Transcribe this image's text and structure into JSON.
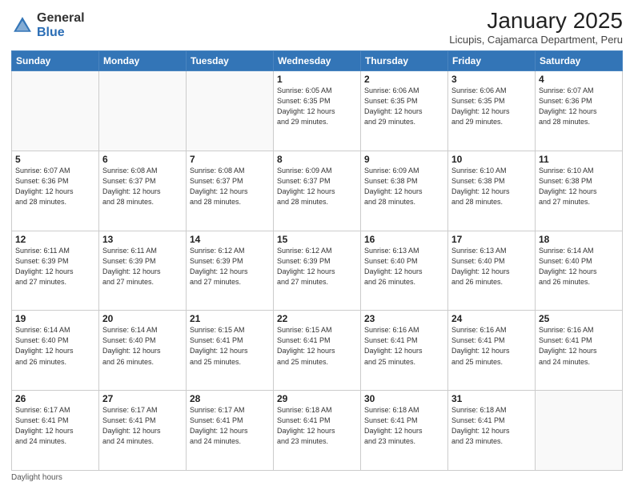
{
  "logo": {
    "general": "General",
    "blue": "Blue"
  },
  "header": {
    "title": "January 2025",
    "subtitle": "Licupis, Cajamarca Department, Peru"
  },
  "days_of_week": [
    "Sunday",
    "Monday",
    "Tuesday",
    "Wednesday",
    "Thursday",
    "Friday",
    "Saturday"
  ],
  "footer": {
    "note": "Daylight hours"
  },
  "weeks": [
    [
      {
        "day": "",
        "info": ""
      },
      {
        "day": "",
        "info": ""
      },
      {
        "day": "",
        "info": ""
      },
      {
        "day": "1",
        "info": "Sunrise: 6:05 AM\nSunset: 6:35 PM\nDaylight: 12 hours\nand 29 minutes."
      },
      {
        "day": "2",
        "info": "Sunrise: 6:06 AM\nSunset: 6:35 PM\nDaylight: 12 hours\nand 29 minutes."
      },
      {
        "day": "3",
        "info": "Sunrise: 6:06 AM\nSunset: 6:35 PM\nDaylight: 12 hours\nand 29 minutes."
      },
      {
        "day": "4",
        "info": "Sunrise: 6:07 AM\nSunset: 6:36 PM\nDaylight: 12 hours\nand 28 minutes."
      }
    ],
    [
      {
        "day": "5",
        "info": "Sunrise: 6:07 AM\nSunset: 6:36 PM\nDaylight: 12 hours\nand 28 minutes."
      },
      {
        "day": "6",
        "info": "Sunrise: 6:08 AM\nSunset: 6:37 PM\nDaylight: 12 hours\nand 28 minutes."
      },
      {
        "day": "7",
        "info": "Sunrise: 6:08 AM\nSunset: 6:37 PM\nDaylight: 12 hours\nand 28 minutes."
      },
      {
        "day": "8",
        "info": "Sunrise: 6:09 AM\nSunset: 6:37 PM\nDaylight: 12 hours\nand 28 minutes."
      },
      {
        "day": "9",
        "info": "Sunrise: 6:09 AM\nSunset: 6:38 PM\nDaylight: 12 hours\nand 28 minutes."
      },
      {
        "day": "10",
        "info": "Sunrise: 6:10 AM\nSunset: 6:38 PM\nDaylight: 12 hours\nand 28 minutes."
      },
      {
        "day": "11",
        "info": "Sunrise: 6:10 AM\nSunset: 6:38 PM\nDaylight: 12 hours\nand 27 minutes."
      }
    ],
    [
      {
        "day": "12",
        "info": "Sunrise: 6:11 AM\nSunset: 6:39 PM\nDaylight: 12 hours\nand 27 minutes."
      },
      {
        "day": "13",
        "info": "Sunrise: 6:11 AM\nSunset: 6:39 PM\nDaylight: 12 hours\nand 27 minutes."
      },
      {
        "day": "14",
        "info": "Sunrise: 6:12 AM\nSunset: 6:39 PM\nDaylight: 12 hours\nand 27 minutes."
      },
      {
        "day": "15",
        "info": "Sunrise: 6:12 AM\nSunset: 6:39 PM\nDaylight: 12 hours\nand 27 minutes."
      },
      {
        "day": "16",
        "info": "Sunrise: 6:13 AM\nSunset: 6:40 PM\nDaylight: 12 hours\nand 26 minutes."
      },
      {
        "day": "17",
        "info": "Sunrise: 6:13 AM\nSunset: 6:40 PM\nDaylight: 12 hours\nand 26 minutes."
      },
      {
        "day": "18",
        "info": "Sunrise: 6:14 AM\nSunset: 6:40 PM\nDaylight: 12 hours\nand 26 minutes."
      }
    ],
    [
      {
        "day": "19",
        "info": "Sunrise: 6:14 AM\nSunset: 6:40 PM\nDaylight: 12 hours\nand 26 minutes."
      },
      {
        "day": "20",
        "info": "Sunrise: 6:14 AM\nSunset: 6:40 PM\nDaylight: 12 hours\nand 26 minutes."
      },
      {
        "day": "21",
        "info": "Sunrise: 6:15 AM\nSunset: 6:41 PM\nDaylight: 12 hours\nand 25 minutes."
      },
      {
        "day": "22",
        "info": "Sunrise: 6:15 AM\nSunset: 6:41 PM\nDaylight: 12 hours\nand 25 minutes."
      },
      {
        "day": "23",
        "info": "Sunrise: 6:16 AM\nSunset: 6:41 PM\nDaylight: 12 hours\nand 25 minutes."
      },
      {
        "day": "24",
        "info": "Sunrise: 6:16 AM\nSunset: 6:41 PM\nDaylight: 12 hours\nand 25 minutes."
      },
      {
        "day": "25",
        "info": "Sunrise: 6:16 AM\nSunset: 6:41 PM\nDaylight: 12 hours\nand 24 minutes."
      }
    ],
    [
      {
        "day": "26",
        "info": "Sunrise: 6:17 AM\nSunset: 6:41 PM\nDaylight: 12 hours\nand 24 minutes."
      },
      {
        "day": "27",
        "info": "Sunrise: 6:17 AM\nSunset: 6:41 PM\nDaylight: 12 hours\nand 24 minutes."
      },
      {
        "day": "28",
        "info": "Sunrise: 6:17 AM\nSunset: 6:41 PM\nDaylight: 12 hours\nand 24 minutes."
      },
      {
        "day": "29",
        "info": "Sunrise: 6:18 AM\nSunset: 6:41 PM\nDaylight: 12 hours\nand 23 minutes."
      },
      {
        "day": "30",
        "info": "Sunrise: 6:18 AM\nSunset: 6:41 PM\nDaylight: 12 hours\nand 23 minutes."
      },
      {
        "day": "31",
        "info": "Sunrise: 6:18 AM\nSunset: 6:41 PM\nDaylight: 12 hours\nand 23 minutes."
      },
      {
        "day": "",
        "info": ""
      }
    ]
  ]
}
